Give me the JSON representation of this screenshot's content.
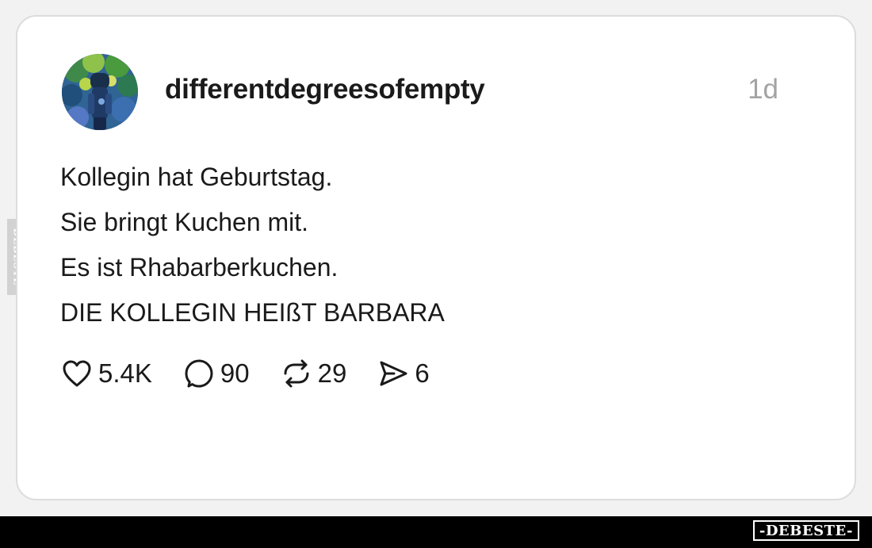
{
  "post": {
    "username": "differentdegreesofempty",
    "timestamp": "1d",
    "lines": [
      "Kollegin hat Geburtstag.",
      "Sie bringt Kuchen mit.",
      "Es ist Rhabarberkuchen.",
      "DIE KOLLEGIN HEIßT BARBARA"
    ],
    "actions": {
      "likes": {
        "icon": "heart-icon",
        "count": "5.4K"
      },
      "comments": {
        "icon": "comment-icon",
        "count": "90"
      },
      "reposts": {
        "icon": "repost-icon",
        "count": "29"
      },
      "shares": {
        "icon": "send-icon",
        "count": "6"
      }
    }
  },
  "watermarks": {
    "side": "DEBESTE",
    "bottom": "-DEBESTE-"
  },
  "colors": {
    "text": "#1a1a1a",
    "muted": "#a3a3a3",
    "card_border": "#dcdcdc",
    "page_background": "#f2f2f2",
    "bottom_bar": "#000000"
  }
}
